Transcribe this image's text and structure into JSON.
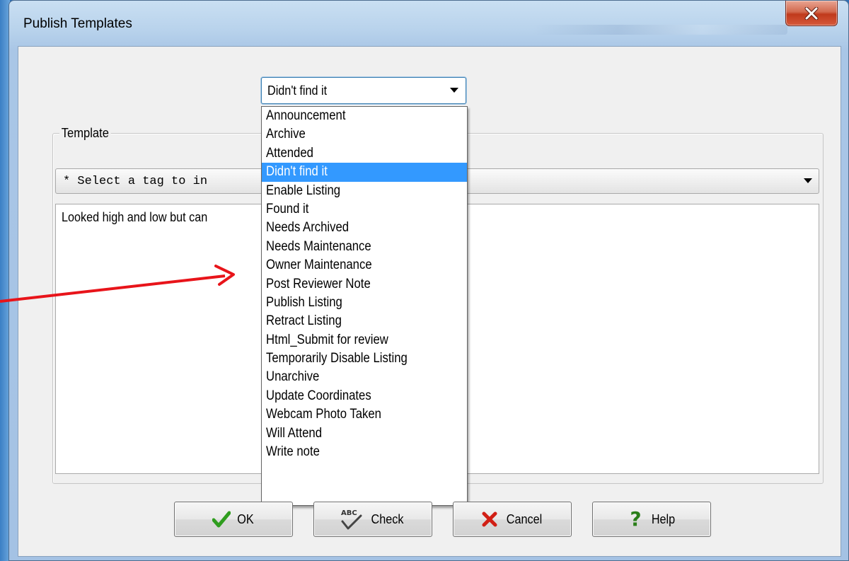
{
  "window": {
    "title": "Publish Templates"
  },
  "tag_combo": {
    "selected": "Didn't find it"
  },
  "template_group": {
    "label": "Template",
    "tag_select_text": "* Select a tag to in",
    "body_text": "Looked high and low but can"
  },
  "dropdown": {
    "items": [
      {
        "label": "Announcement"
      },
      {
        "label": "Archive"
      },
      {
        "label": "Attended"
      },
      {
        "label": "Didn't find it",
        "selected": true
      },
      {
        "label": "Enable Listing"
      },
      {
        "label": "Found it"
      },
      {
        "label": "Needs Archived"
      },
      {
        "label": "Needs Maintenance"
      },
      {
        "label": "Owner Maintenance"
      },
      {
        "label": "Post Reviewer Note"
      },
      {
        "label": "Publish Listing"
      },
      {
        "label": "Retract Listing"
      },
      {
        "label": "Html_Submit for review"
      },
      {
        "label": "Temporarily Disable Listing"
      },
      {
        "label": "Unarchive"
      },
      {
        "label": "Update Coordinates"
      },
      {
        "label": "Webcam Photo Taken"
      },
      {
        "label": "Will Attend"
      },
      {
        "label": "Write note"
      }
    ]
  },
  "buttons": {
    "ok": "OK",
    "check": "Check",
    "check_icon_text": "ABC",
    "cancel": "Cancel",
    "help": "Help"
  },
  "colors": {
    "selection": "#3399ff",
    "annotation_arrow": "#e8141a",
    "ok_check": "#2f9d1e",
    "cancel_x": "#d11f15",
    "help_question": "#2a7e19"
  },
  "icons": [
    "close-icon",
    "dropdown-arrow-icon",
    "check-mark-icon",
    "spellcheck-icon",
    "cancel-x-icon",
    "help-question-icon"
  ]
}
